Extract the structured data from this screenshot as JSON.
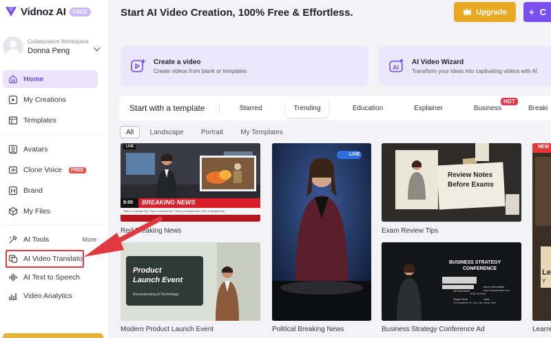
{
  "brand": {
    "name": "Vidnoz AI",
    "badge": "FREE",
    "accent": "#7a4ff0"
  },
  "workspace": {
    "label": "Collaborative Workspace",
    "user": "Donna Peng"
  },
  "sidebar": {
    "items": [
      {
        "label": "Home",
        "icon": "home-icon"
      },
      {
        "label": "My Creations",
        "icon": "play-square-icon"
      },
      {
        "label": "Templates",
        "icon": "template-icon"
      },
      {
        "label": "Avatars",
        "icon": "user-icon"
      },
      {
        "label": "Clone Voice",
        "icon": "voice-icon",
        "badge": "FREE"
      },
      {
        "label": "Brand",
        "icon": "brand-icon"
      },
      {
        "label": "My Files",
        "icon": "folder-icon"
      },
      {
        "label": "AI Tools",
        "icon": "tools-icon",
        "more": "More"
      },
      {
        "label": "AI Video Translator",
        "icon": "translate-icon"
      },
      {
        "label": "AI Text to Speech",
        "icon": "waveform-icon"
      },
      {
        "label": "Video Analytics",
        "icon": "chart-icon"
      }
    ]
  },
  "header": {
    "title": "Start AI Video Creation, 100% Free & Effortless.",
    "upgrade_label": "Upgrade",
    "create_label": "C"
  },
  "actions": [
    {
      "title": "Create a video",
      "subtitle": "Create videos from blank or templates"
    },
    {
      "title": "AI Video Wizard",
      "subtitle": "Transform your ideas into captivating videos with AI"
    }
  ],
  "templates": {
    "title": "Start with a template",
    "tabs": [
      "Starred",
      "Trending",
      "Education",
      "Explainer",
      "Business",
      "Breaki"
    ],
    "hot_badge": "HOT",
    "subtabs": [
      "All",
      "Landscape",
      "Portrait",
      "My Templates"
    ]
  },
  "videos": [
    {
      "caption": "Red Breaking News",
      "overlay": "BREAKING NEWS",
      "time": "9:00",
      "ticker": "This is a sample text. Here a sample text. This is a sample text. Here a sample text.",
      "live": "LIVE"
    },
    {
      "caption": "Modern Product Launch Event",
      "overlay_line1": "Product",
      "overlay_line2": "Launch Event",
      "overlay_sub": "Revolutionizing AI Technology"
    },
    {
      "caption": "Political Breaking News",
      "live": "LIVE"
    },
    {
      "caption": "Exam Review Tips",
      "note_line1": "Review Notes",
      "note_line2": "Before Exams"
    },
    {
      "caption": "Business Strategy Conference Ad",
      "overlay_line1": "BUSINESS STRATEGY",
      "overlay_line2": "CONFERENCE",
      "day": "Sunday",
      "date": "28 December",
      "time": "9:00 To 3:00",
      "more_info": "More Information:",
      "website": "www.reallygreatsite.com",
      "venue": "Studio Real",
      "address": "123 Anywhere St., Any City",
      "host_label": "Host:",
      "host": "Sarah Kline"
    },
    {
      "caption": "Learni",
      "badge": "NEW",
      "overlay_l1": "Le",
      "overlay_l2": "Y"
    }
  ]
}
